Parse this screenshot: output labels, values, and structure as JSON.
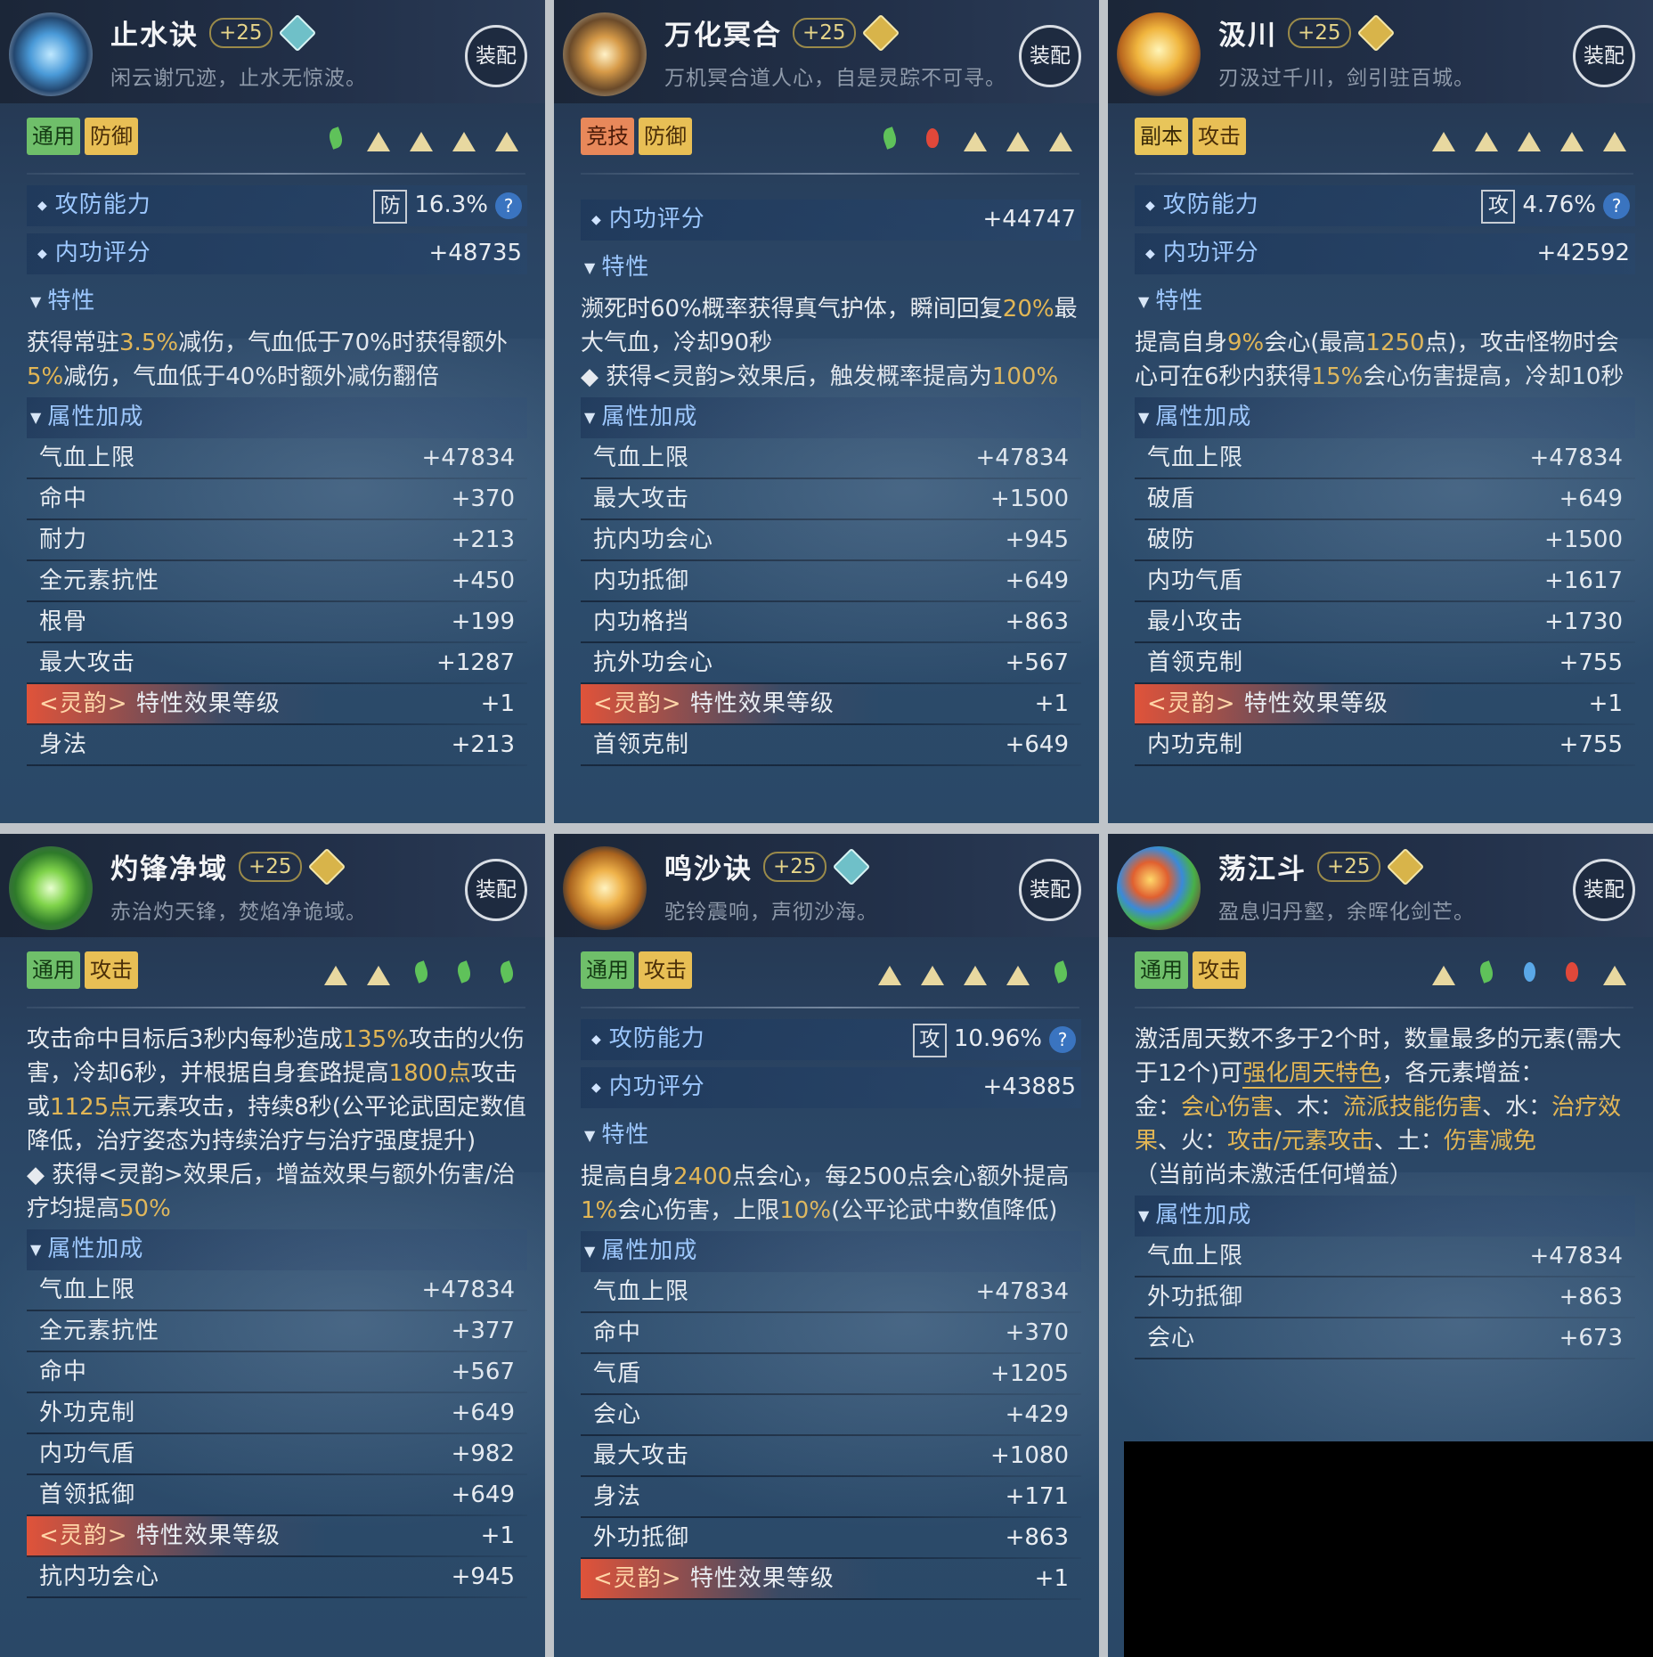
{
  "cards": [
    {
      "title": "止水诀",
      "plus": "+25",
      "gem": "teal",
      "subtitle": "闲云谢冗迹，止水无惊波。",
      "equip": "装配",
      "tags": [
        {
          "label": "通用",
          "color": "green"
        },
        {
          "label": "防御",
          "color": "gold"
        }
      ],
      "slots": [
        "leaf",
        "mount",
        "mount",
        "mount",
        "mount"
      ],
      "rows": [
        {
          "label": "攻防能力",
          "badge": "防",
          "value": "16.3%",
          "help": "?"
        },
        {
          "label": "内功评分",
          "value": "+48735"
        }
      ],
      "trait_header": "特性",
      "trait_segments": [
        {
          "t": "获得常驻"
        },
        {
          "t": "3.5%",
          "hi": true
        },
        {
          "t": "减伤，气血低于70%时获得额外"
        },
        {
          "t": "5%",
          "hi": true
        },
        {
          "t": "减伤，气血低于40%时额外减伤翻倍"
        }
      ],
      "attr_header": "属性加成",
      "attrs": [
        {
          "name": "气血上限",
          "value": "+47834"
        },
        {
          "name": "命中",
          "value": "+370"
        },
        {
          "name": "耐力",
          "value": "+213"
        },
        {
          "name": "全元素抗性",
          "value": "+450"
        },
        {
          "name": "根骨",
          "value": "+199"
        },
        {
          "name": "最大攻击",
          "value": "+1287"
        },
        {
          "name": "特性效果等级",
          "value": "+1",
          "spec": true,
          "prefix": "<灵韵>"
        },
        {
          "name": "身法",
          "value": "+213"
        }
      ]
    },
    {
      "title": "万化冥合",
      "plus": "+25",
      "gem": "gold",
      "subtitle": "万机冥合道人心，自是灵踪不可寻。",
      "equip": "装配",
      "tags": [
        {
          "label": "竞技",
          "color": "orange"
        },
        {
          "label": "防御",
          "color": "gold"
        }
      ],
      "slots": [
        "leaf",
        "fire",
        "mount",
        "mount",
        "mount"
      ],
      "rows": [
        {
          "label": "内功评分",
          "value": "+44747"
        }
      ],
      "trait_header": "特性",
      "trait_segments": [
        {
          "t": "濒死时60%概率获得真气护体，瞬间回复"
        },
        {
          "t": "20%",
          "hi": true
        },
        {
          "t": "最大气血，冷却90秒"
        },
        {
          "br": true
        },
        {
          "t": "◆ 获得<灵韵>效果后，触发概率提高为"
        },
        {
          "t": "100%",
          "hi": true
        }
      ],
      "attr_header": "属性加成",
      "attrs": [
        {
          "name": "气血上限",
          "value": "+47834"
        },
        {
          "name": "最大攻击",
          "value": "+1500"
        },
        {
          "name": "抗内功会心",
          "value": "+945"
        },
        {
          "name": "内功抵御",
          "value": "+649"
        },
        {
          "name": "内功格挡",
          "value": "+863"
        },
        {
          "name": "抗外功会心",
          "value": "+567"
        },
        {
          "name": "特性效果等级",
          "value": "+1",
          "spec": true,
          "prefix": "<灵韵>"
        },
        {
          "name": "首领克制",
          "value": "+649"
        }
      ]
    },
    {
      "title": "汲川",
      "plus": "+25",
      "gem": "gold",
      "subtitle": "刃汲过千川，剑引驻百城。",
      "equip": "装配",
      "tags": [
        {
          "label": "副本",
          "color": "yellow"
        },
        {
          "label": "攻击",
          "color": "gold"
        }
      ],
      "slots": [
        "mount",
        "mount",
        "mount",
        "mount",
        "mount"
      ],
      "rows": [
        {
          "label": "攻防能力",
          "badge": "攻",
          "value": "4.76%",
          "help": "?"
        },
        {
          "label": "内功评分",
          "value": "+42592"
        }
      ],
      "trait_header": "特性",
      "trait_segments": [
        {
          "t": "提高自身"
        },
        {
          "t": "9%",
          "hi": true
        },
        {
          "t": "会心(最高"
        },
        {
          "t": "1250",
          "hi": true
        },
        {
          "t": "点)，攻击怪物时会心可在6秒内获得"
        },
        {
          "t": "15%",
          "hi": true
        },
        {
          "t": "会心伤害提高，冷却10秒"
        }
      ],
      "attr_header": "属性加成",
      "attrs": [
        {
          "name": "气血上限",
          "value": "+47834"
        },
        {
          "name": "破盾",
          "value": "+649"
        },
        {
          "name": "破防",
          "value": "+1500"
        },
        {
          "name": "内功气盾",
          "value": "+1617"
        },
        {
          "name": "最小攻击",
          "value": "+1730"
        },
        {
          "name": "首领克制",
          "value": "+755"
        },
        {
          "name": "特性效果等级",
          "value": "+1",
          "spec": true,
          "prefix": "<灵韵>"
        },
        {
          "name": "内功克制",
          "value": "+755"
        }
      ]
    },
    {
      "title": "灼锋净域",
      "plus": "+25",
      "gem": "gold",
      "subtitle": "赤治灼天锋，焚焰净诡域。",
      "equip": "装配",
      "tags": [
        {
          "label": "通用",
          "color": "green"
        },
        {
          "label": "攻击",
          "color": "gold"
        }
      ],
      "slots": [
        "mount",
        "mount",
        "leaf",
        "leaf",
        "leaf"
      ],
      "rows": [],
      "trait_header": "",
      "trait_segments": [
        {
          "t": "攻击命中目标后3秒内每秒造成"
        },
        {
          "t": "135%",
          "hi": true
        },
        {
          "t": "攻击的火伤害，冷却6秒，并根据自身套路提高"
        },
        {
          "t": "1800点",
          "hi": true
        },
        {
          "t": "攻击或"
        },
        {
          "t": "1125点",
          "hi": true
        },
        {
          "t": "元素攻击，持续8秒(公平论武固定数值降低，治疗姿态为持续治疗与治疗强度提升)"
        },
        {
          "br": true
        },
        {
          "t": "◆ 获得<灵韵>效果后，增益效果与额外伤害/治疗均提高"
        },
        {
          "t": "50%",
          "hi": true
        }
      ],
      "attr_header": "属性加成",
      "attrs": [
        {
          "name": "气血上限",
          "value": "+47834"
        },
        {
          "name": "全元素抗性",
          "value": "+377"
        },
        {
          "name": "命中",
          "value": "+567"
        },
        {
          "name": "外功克制",
          "value": "+649"
        },
        {
          "name": "内功气盾",
          "value": "+982"
        },
        {
          "name": "首领抵御",
          "value": "+649"
        },
        {
          "name": "特性效果等级",
          "value": "+1",
          "spec": true,
          "prefix": "<灵韵>"
        },
        {
          "name": "抗内功会心",
          "value": "+945"
        }
      ]
    },
    {
      "title": "鸣沙诀",
      "plus": "+25",
      "gem": "teal",
      "subtitle": "驼铃震响，声彻沙海。",
      "equip": "装配",
      "tags": [
        {
          "label": "通用",
          "color": "green"
        },
        {
          "label": "攻击",
          "color": "gold"
        }
      ],
      "slots": [
        "mount",
        "mount",
        "mount",
        "mount",
        "leaf"
      ],
      "rows": [
        {
          "label": "攻防能力",
          "badge": "攻",
          "value": "10.96%",
          "help": "?"
        },
        {
          "label": "内功评分",
          "value": "+43885"
        }
      ],
      "trait_header": "特性",
      "trait_segments": [
        {
          "t": "提高自身"
        },
        {
          "t": "2400",
          "hi": true
        },
        {
          "t": "点会心，每2500点会心额外提高"
        },
        {
          "t": "1%",
          "hi": true
        },
        {
          "t": "会心伤害，上限"
        },
        {
          "t": "10%",
          "hi": true
        },
        {
          "t": "(公平论武中数值降低)"
        }
      ],
      "attr_header": "属性加成",
      "attrs": [
        {
          "name": "气血上限",
          "value": "+47834"
        },
        {
          "name": "命中",
          "value": "+370"
        },
        {
          "name": "气盾",
          "value": "+1205"
        },
        {
          "name": "会心",
          "value": "+429"
        },
        {
          "name": "最大攻击",
          "value": "+1080"
        },
        {
          "name": "身法",
          "value": "+171"
        },
        {
          "name": "外功抵御",
          "value": "+863"
        },
        {
          "name": "特性效果等级",
          "value": "+1",
          "spec": true,
          "prefix": "<灵韵>"
        }
      ]
    },
    {
      "title": "荡江斗",
      "plus": "+25",
      "gem": "gold",
      "subtitle": "盈息归丹壑，余晖化剑芒。",
      "equip": "装配",
      "tags": [
        {
          "label": "通用",
          "color": "green"
        },
        {
          "label": "攻击",
          "color": "gold"
        }
      ],
      "slots": [
        "mount",
        "leaf",
        "water",
        "fire",
        "mount"
      ],
      "rows": [],
      "trait_header": "",
      "trait_segments": [
        {
          "t": "激活周天数不多于2个时，数量最多的元素(需大于12个)可"
        },
        {
          "t": "强化周天特色",
          "ul": true
        },
        {
          "t": "，各元素增益："
        },
        {
          "br": true
        },
        {
          "t": "金："
        },
        {
          "t": "会心伤害",
          "hi": true
        },
        {
          "t": "、木："
        },
        {
          "t": "流派技能伤害",
          "hi": true
        },
        {
          "t": "、水："
        },
        {
          "t": "治疗效果",
          "hi": true
        },
        {
          "t": "、火："
        },
        {
          "t": "攻击/元素攻击",
          "hi": true
        },
        {
          "t": "、土："
        },
        {
          "t": "伤害减免",
          "hi": true
        },
        {
          "br": true
        },
        {
          "t": "（当前尚未激活任何增益）"
        }
      ],
      "attr_header": "属性加成",
      "attrs": [
        {
          "name": "气血上限",
          "value": "+47834"
        },
        {
          "name": "外功抵御",
          "value": "+863"
        },
        {
          "name": "会心",
          "value": "+673"
        }
      ]
    }
  ]
}
